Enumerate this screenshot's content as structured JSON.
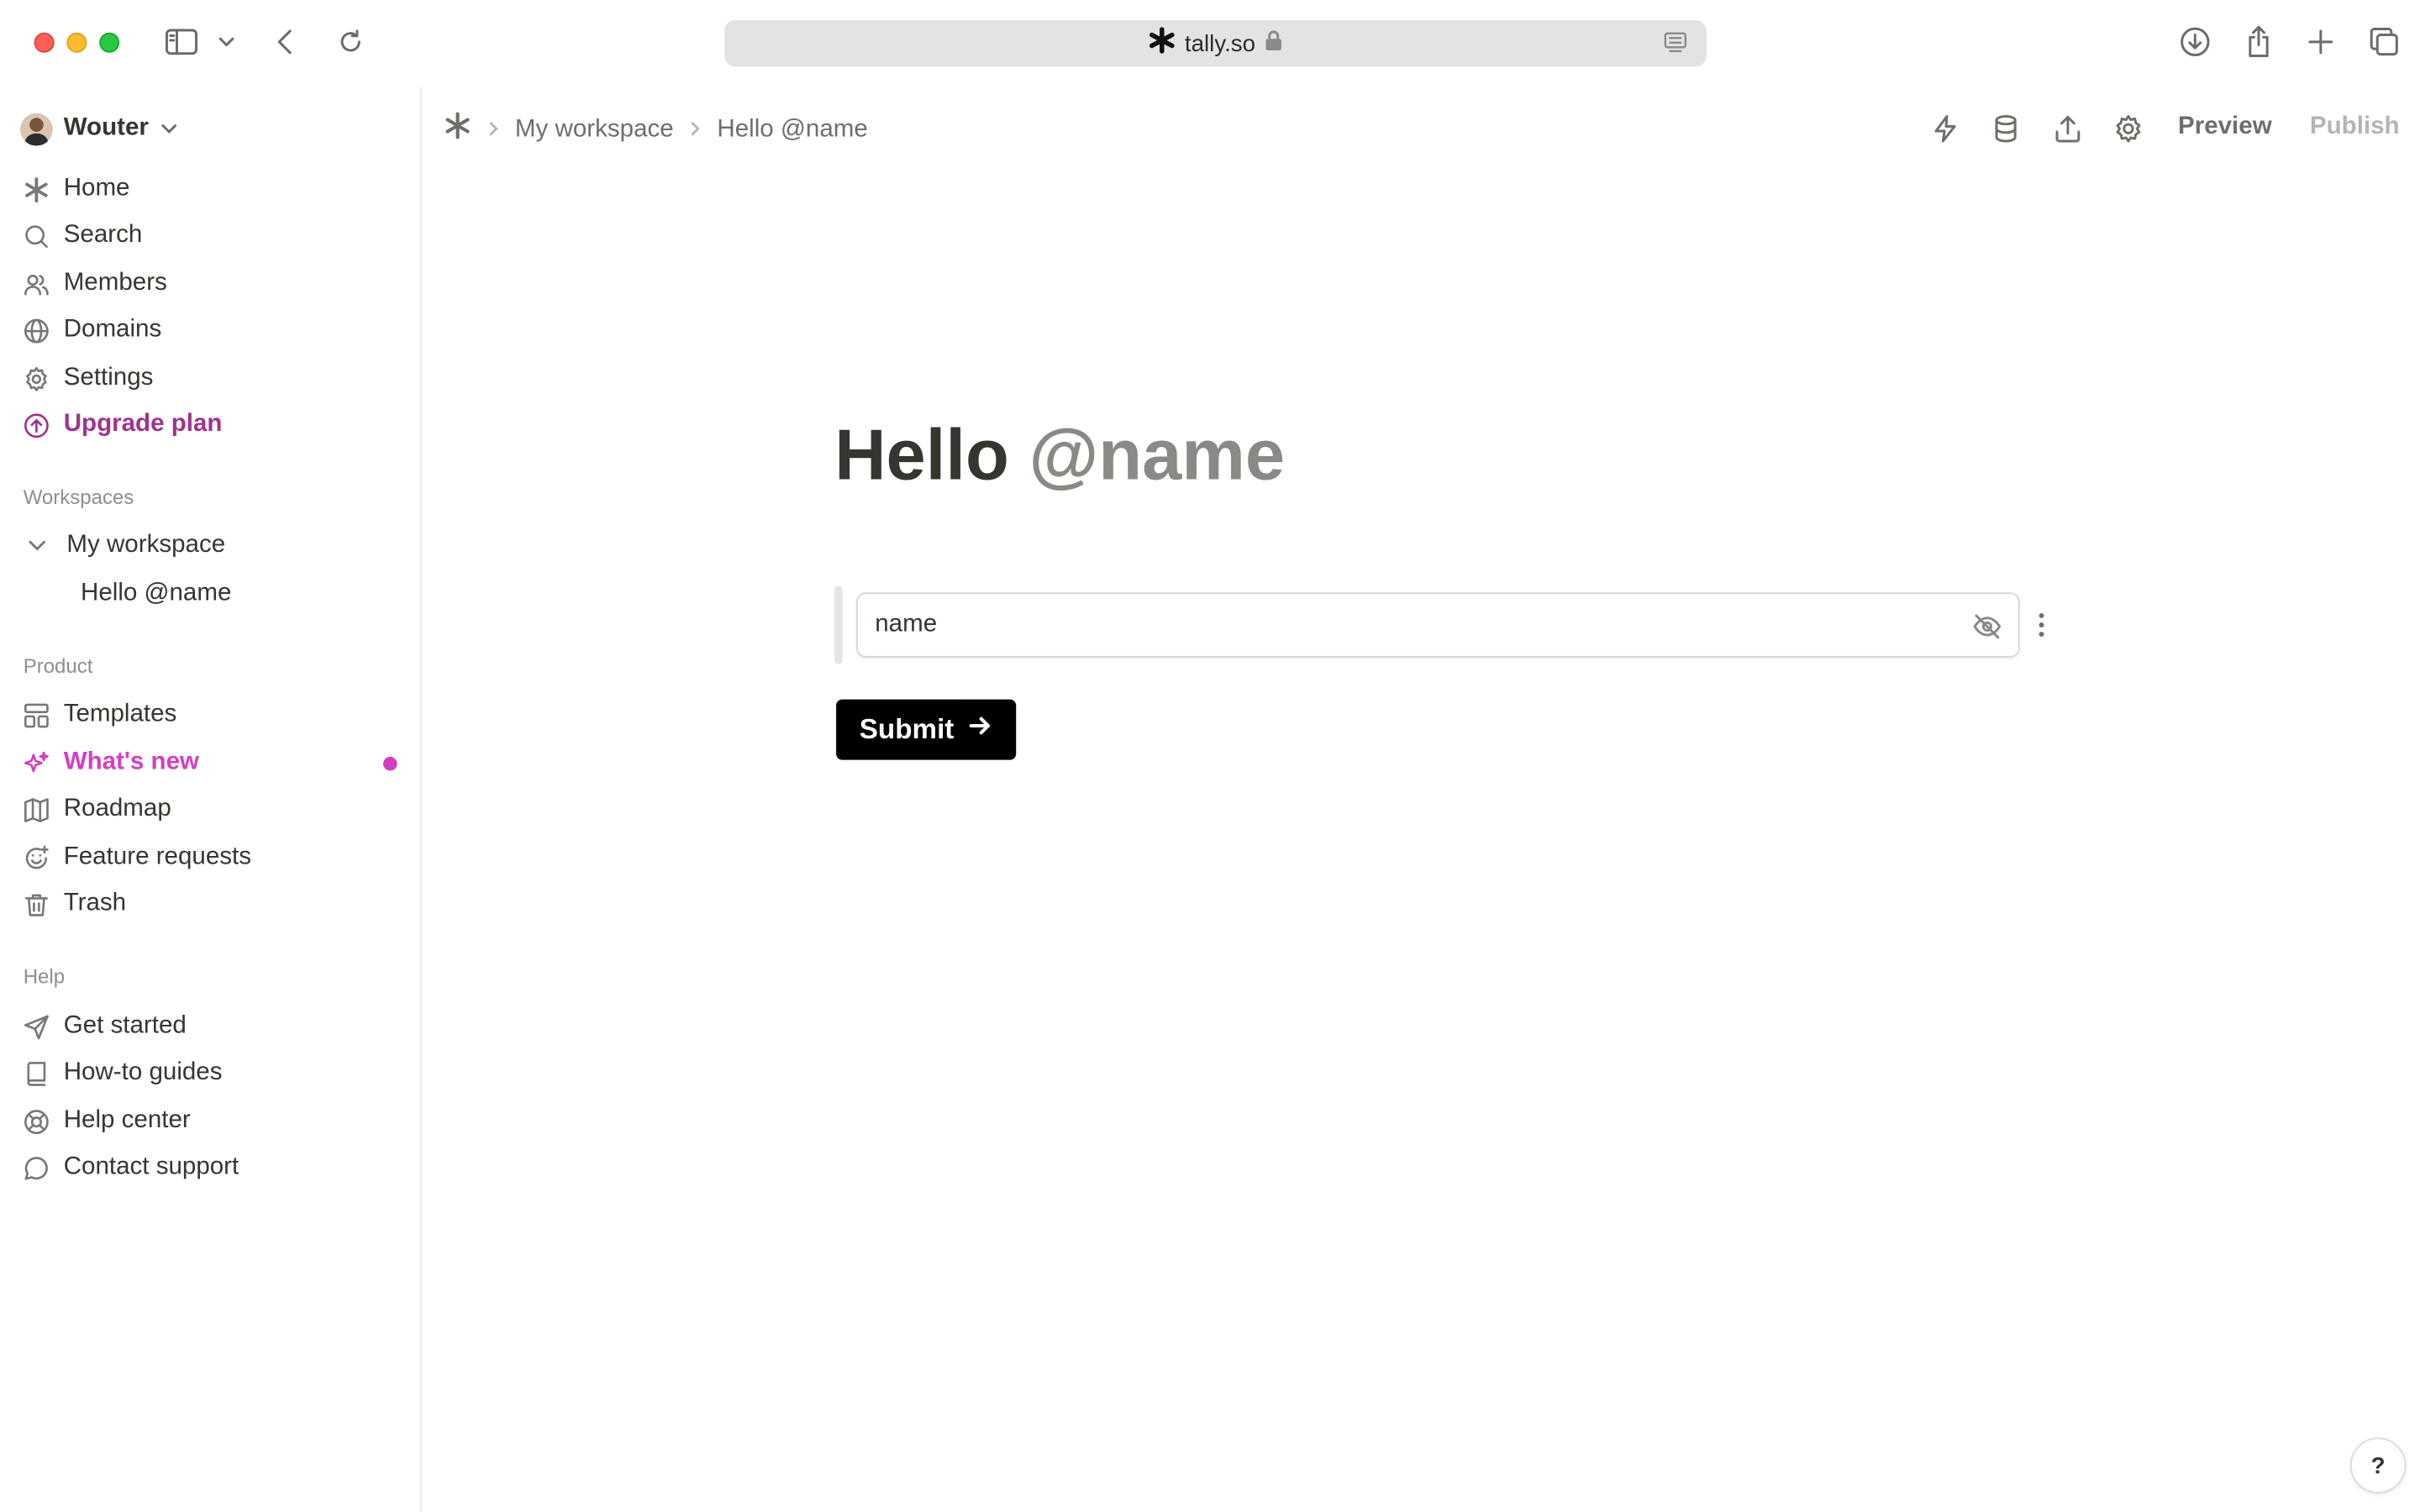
{
  "browser": {
    "url": "tally.so",
    "icons": [
      "sidebar-icon",
      "chevron-down-icon",
      "back-icon",
      "reload-icon",
      "lock-icon",
      "reader-icon",
      "download-icon",
      "share-icon",
      "new-tab-icon",
      "tabs-overview-icon"
    ]
  },
  "sidebar": {
    "user_name": "Wouter",
    "primary_items": [
      {
        "label": "Home",
        "icon": "tally-logo-icon"
      },
      {
        "label": "Search",
        "icon": "search-icon"
      },
      {
        "label": "Members",
        "icon": "members-icon"
      },
      {
        "label": "Domains",
        "icon": "globe-icon"
      },
      {
        "label": "Settings",
        "icon": "gear-icon"
      },
      {
        "label": "Upgrade plan",
        "icon": "upgrade-icon"
      }
    ],
    "workspaces_label": "Workspaces",
    "workspace_name": "My workspace",
    "workspace_form": "Hello @name",
    "product_label": "Product",
    "product_items": [
      {
        "label": "Templates",
        "icon": "templates-icon"
      },
      {
        "label": "What's new",
        "icon": "sparkle-icon"
      },
      {
        "label": "Roadmap",
        "icon": "map-icon"
      },
      {
        "label": "Feature requests",
        "icon": "feature-request-icon"
      },
      {
        "label": "Trash",
        "icon": "trash-icon"
      }
    ],
    "help_label": "Help",
    "help_items": [
      {
        "label": "Get started",
        "icon": "send-icon"
      },
      {
        "label": "How-to guides",
        "icon": "book-icon"
      },
      {
        "label": "Help center",
        "icon": "lifebuoy-icon"
      },
      {
        "label": "Contact support",
        "icon": "chat-icon"
      }
    ]
  },
  "topbar": {
    "breadcrumb_workspace": "My workspace",
    "breadcrumb_form": "Hello @name",
    "preview_label": "Preview",
    "publish_label": "Publish"
  },
  "form": {
    "title_text": "Hello",
    "title_mention": "@name",
    "field_value": "name",
    "submit_label": "Submit"
  },
  "help_button_label": "?",
  "colors": {
    "upgrade": "#a1328e",
    "whats_new": "#d43ec1",
    "submit_bg": "#000000"
  }
}
